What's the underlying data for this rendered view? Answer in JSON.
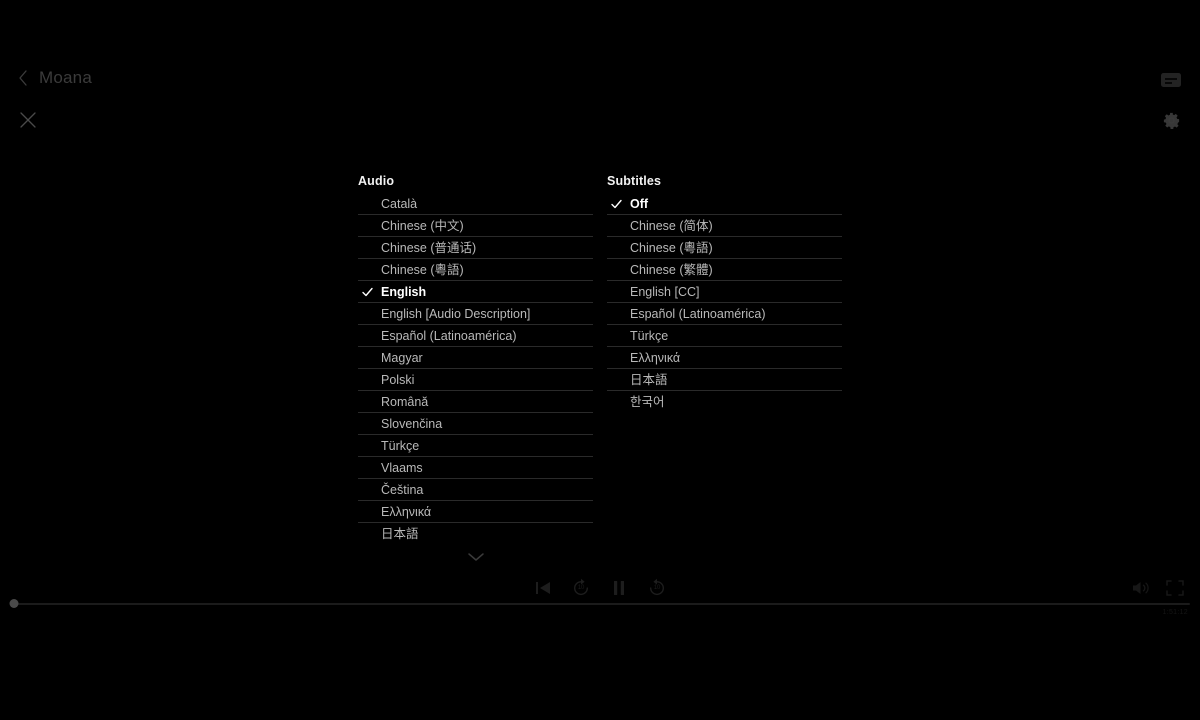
{
  "player": {
    "title": "Moana",
    "back_icon": "chevron-left-icon",
    "close_icon": "close-icon",
    "cc_icon": "closed-captions-icon",
    "settings_icon": "gear-icon",
    "accent_color": "#ffffff",
    "background_color": "#000000",
    "divider_color": "#2a2a2a",
    "label_color": "#b9b9b9"
  },
  "audio_panel": {
    "heading": "Audio",
    "more_icon": "chevron-down-icon",
    "selected": "English",
    "tracks": [
      {
        "label": "Català",
        "selected": false
      },
      {
        "label": "Chinese (中文)",
        "selected": false
      },
      {
        "label": "Chinese (普通话)",
        "selected": false
      },
      {
        "label": "Chinese (粵語)",
        "selected": false
      },
      {
        "label": "English",
        "selected": true
      },
      {
        "label": "English [Audio Description]",
        "selected": false
      },
      {
        "label": "Español (Latinoamérica)",
        "selected": false
      },
      {
        "label": "Magyar",
        "selected": false
      },
      {
        "label": "Polski",
        "selected": false
      },
      {
        "label": "Română",
        "selected": false
      },
      {
        "label": "Slovenčina",
        "selected": false
      },
      {
        "label": "Türkçe",
        "selected": false
      },
      {
        "label": "Vlaams",
        "selected": false
      },
      {
        "label": "Čeština",
        "selected": false
      },
      {
        "label": "Ελληνικά",
        "selected": false
      },
      {
        "label": "日本語",
        "selected": false
      }
    ]
  },
  "subtitles_panel": {
    "heading": "Subtitles",
    "selected": "Off",
    "tracks": [
      {
        "label": "Off",
        "selected": true
      },
      {
        "label": "Chinese (简体)",
        "selected": false
      },
      {
        "label": "Chinese (粵語)",
        "selected": false
      },
      {
        "label": "Chinese (繁體)",
        "selected": false
      },
      {
        "label": "English [CC]",
        "selected": false
      },
      {
        "label": "Español (Latinoamérica)",
        "selected": false
      },
      {
        "label": "Türkçe",
        "selected": false
      },
      {
        "label": "Ελληνικά",
        "selected": false
      },
      {
        "label": "日本語",
        "selected": false
      },
      {
        "label": "한국어",
        "selected": false
      }
    ]
  },
  "controls": {
    "skip_previous": {
      "name": "skip-previous-icon",
      "label": ""
    },
    "rewind": {
      "name": "rewind-10-icon",
      "label": "10"
    },
    "play_pause": {
      "name": "pause-icon",
      "label": ""
    },
    "forward": {
      "name": "forward-10-icon",
      "label": "10"
    },
    "volume": {
      "name": "volume-icon",
      "label": ""
    },
    "fullscreen": {
      "name": "fullscreen-icon",
      "label": ""
    },
    "time_remaining": "1:51:12",
    "progress_percent": 0.35
  }
}
